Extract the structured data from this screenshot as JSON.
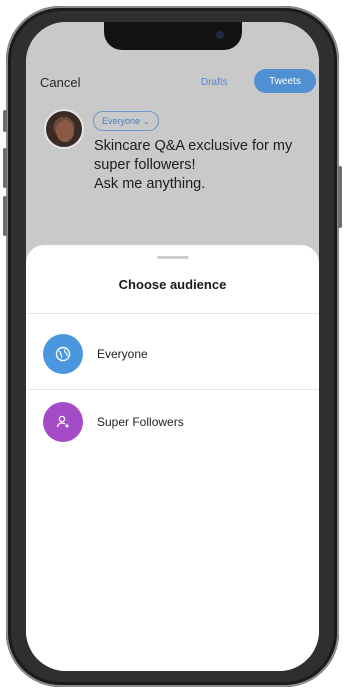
{
  "composer": {
    "cancel_label": "Cancel",
    "drafts_label": "Drafts",
    "tweet_label": "Tweets",
    "audience_pill": "Everyone",
    "tweet_lines": [
      "Skincare Q&A exclusive for my",
      "super followers!",
      "Ask me anything."
    ]
  },
  "sheet": {
    "title": "Choose audience",
    "options": [
      {
        "label": "Everyone",
        "icon": "globe-icon",
        "color": "#4a97e0"
      },
      {
        "label": "Super Followers",
        "icon": "super-follower-icon",
        "color": "#a54bc8"
      }
    ]
  },
  "colors": {
    "accent": "#4f8fd2",
    "dim_overlay": "#c9c9c9"
  }
}
